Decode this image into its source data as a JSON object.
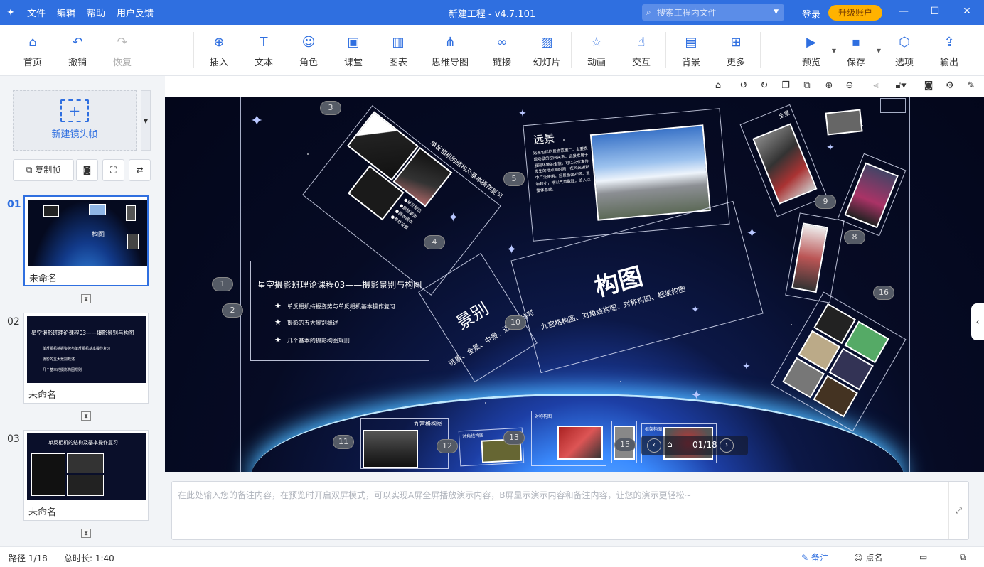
{
  "app": {
    "menu": [
      "文件",
      "编辑",
      "帮助",
      "用户反馈"
    ],
    "title": "新建工程 - v4.7.101",
    "search_placeholder": "搜索工程内文件",
    "login": "登录",
    "upgrade": "升级账户"
  },
  "toolbar": {
    "home": "首页",
    "undo": "撤销",
    "redo": "恢复",
    "insert": "插入",
    "text": "文本",
    "role": "角色",
    "classroom": "课堂",
    "chart": "图表",
    "mindmap": "思维导图",
    "link": "链接",
    "slideshow": "幻灯片",
    "animation": "动画",
    "interaction": "交互",
    "background": "背景",
    "more": "更多",
    "preview": "预览",
    "save": "保存",
    "options": "选项",
    "export": "输出"
  },
  "left_panel": {
    "new_frame": "新建镜头帧",
    "copy_frame": "复制帧",
    "slides": [
      {
        "index": "01",
        "name": "未命名"
      },
      {
        "index": "02",
        "name": "未命名"
      },
      {
        "index": "03",
        "name": "未命名"
      }
    ]
  },
  "thumbs": {
    "t1_title": "构图",
    "t2_title": "星空摄影班理论课程03——摄影景别与构图",
    "t2_b1": "单反相机持握姿势与单反相机基本操作复习",
    "t2_b2": "摄影的五大景别概述",
    "t2_b3": "几个基本的摄影构图规则",
    "t3_title": "单反相机的结构及基本操作复习"
  },
  "canvas": {
    "main_title": "星空摄影班理论课程03——摄影景别与构图",
    "bullets": [
      "单反相机持握姿势与单反相机基本操作复习",
      "摄影的五大景别概述",
      "几个基本的摄影构图规则"
    ],
    "camera_title": "单反相机的结构及基本操作复习",
    "camera_notes": [
      "●单反相机",
      "●握持姿势",
      "●基本操作",
      "●参数设置"
    ],
    "far_view_title": "远景",
    "far_view_text": "远景包括的景物范围广，主要表现场景的空间关系，远景常用于展现环境的全貌，可以交代事件发生的地点和时间，在风光摄影中广泛使用，远景画面开阔，景物较小，常以气势取胜，给人以整体感受。",
    "shot_types_big": "景别",
    "shot_types_text": "远景、全景、中景、近景、特写",
    "composition_big": "构图",
    "composition_text": "九宫格构图、对角线构图、对称构图、框架构图",
    "panel_grid": "九宫格构图",
    "panel_diag": "对角线构图",
    "panel_sym": "对称构图",
    "panel_frame": "框架构图",
    "panel_full": "全景",
    "badges": [
      "1",
      "2",
      "3",
      "4",
      "5",
      "9",
      "8",
      "10",
      "11",
      "12",
      "13",
      "15",
      "16"
    ],
    "pager": "01/18"
  },
  "notes": {
    "placeholder": "在此处输入您的备注内容，在预览时开启双屏模式，可以实现A屏全屏播放演示内容，B屏显示演示内容和备注内容，让您的演示更轻松~"
  },
  "status": {
    "path": "路径 1/18",
    "duration": "总时长: 1:40",
    "notes_btn": "备注",
    "rollcall_btn": "点名"
  },
  "colors": {
    "accent": "#2f6fe0",
    "upgrade": "#ffb200"
  }
}
